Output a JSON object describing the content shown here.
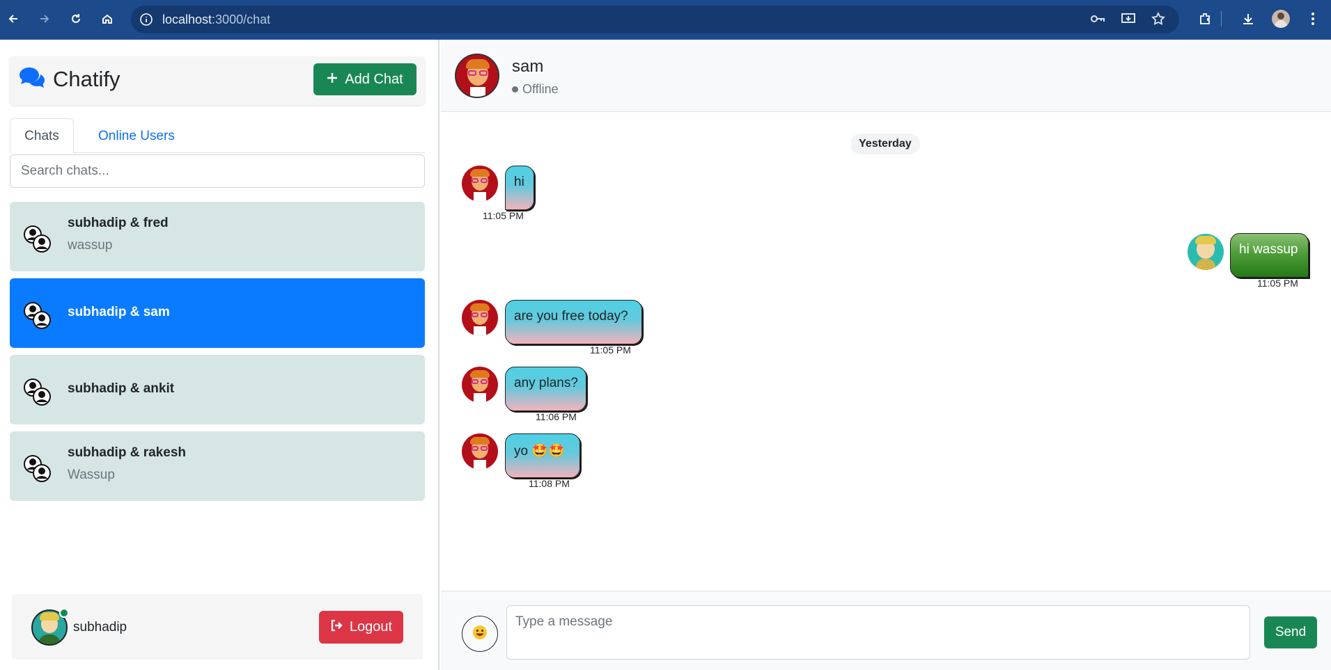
{
  "browser": {
    "url_host": "localhost",
    "url_path": ":3000/chat"
  },
  "sidebar": {
    "brand": "Chatify",
    "add_chat_label": "Add Chat",
    "tabs": [
      {
        "label": "Chats",
        "active": true
      },
      {
        "label": "Online Users",
        "active": false
      }
    ],
    "search_placeholder": "Search chats...",
    "chats": [
      {
        "name": "subhadip & fred",
        "last": "wassup",
        "selected": false
      },
      {
        "name": "subhadip & sam",
        "last": "",
        "selected": true
      },
      {
        "name": "subhadip & ankit",
        "last": "",
        "selected": false
      },
      {
        "name": "subhadip & rakesh",
        "last": "Wassup",
        "selected": false
      }
    ],
    "user": {
      "name": "subhadip",
      "online": true
    },
    "logout_label": "Logout"
  },
  "chat": {
    "name": "sam",
    "status": "Offline",
    "date_label": "Yesterday",
    "messages": [
      {
        "text": "hi",
        "time": "11:05 PM",
        "mine": false
      },
      {
        "text": "hi wassup",
        "time": "11:05 PM",
        "mine": true
      },
      {
        "text": "are you free today?",
        "time": "11:05 PM",
        "mine": false
      },
      {
        "text": "any plans?",
        "time": "11:06 PM",
        "mine": false
      },
      {
        "text": "yo 🤩🤩",
        "time": "11:08 PM",
        "mine": false
      }
    ],
    "input_placeholder": "Type a message",
    "send_label": "Send"
  },
  "colors": {
    "primary": "#0a7bff",
    "success": "#198754",
    "danger": "#dc3545",
    "chat_item_bg": "#d6e6e5",
    "browser_bar": "#1c4a8a"
  }
}
